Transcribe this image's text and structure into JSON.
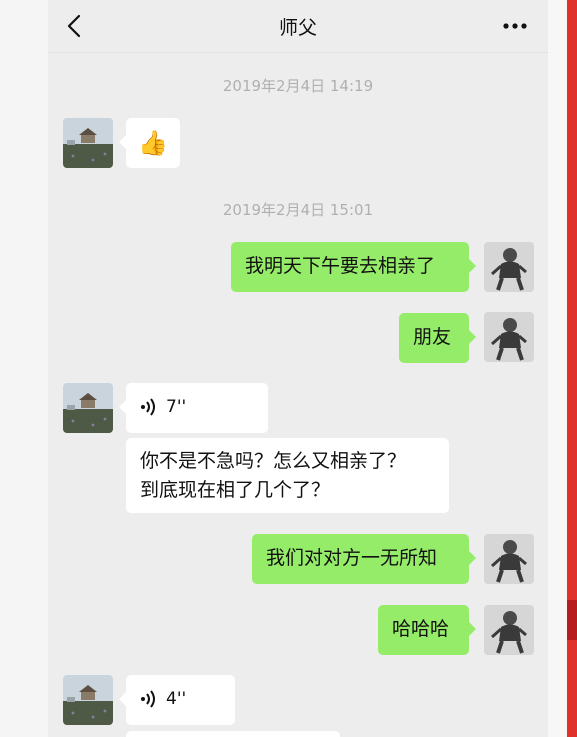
{
  "header": {
    "title": "师父",
    "back_icon": "chevron-left-icon",
    "more_icon": "more-dots-icon"
  },
  "timestamps": [
    "2019年2月4日 14:19",
    "2019年2月4日 15:01"
  ],
  "messages": [
    {
      "from": "friend",
      "type": "emoji",
      "emoji": "👍"
    },
    {
      "from": "me",
      "type": "text",
      "text": "我明天下午要去相亲了"
    },
    {
      "from": "me",
      "type": "text",
      "text": "朋友"
    },
    {
      "from": "friend",
      "type": "voice",
      "duration": "7''"
    },
    {
      "from": "friend",
      "type": "text",
      "line1": "你不是不急吗？怎么又相亲了？",
      "line2": "到底现在相了几个了？"
    },
    {
      "from": "me",
      "type": "text",
      "text": "我们对对方一无所知"
    },
    {
      "from": "me",
      "type": "text",
      "text": "哈哈哈"
    },
    {
      "from": "friend",
      "type": "voice",
      "duration": "4''"
    }
  ],
  "colors": {
    "chat_bg": "#ededed",
    "outgoing_bubble": "#95ec69",
    "incoming_bubble": "#ffffff",
    "timestamp": "#b0b0b0"
  }
}
